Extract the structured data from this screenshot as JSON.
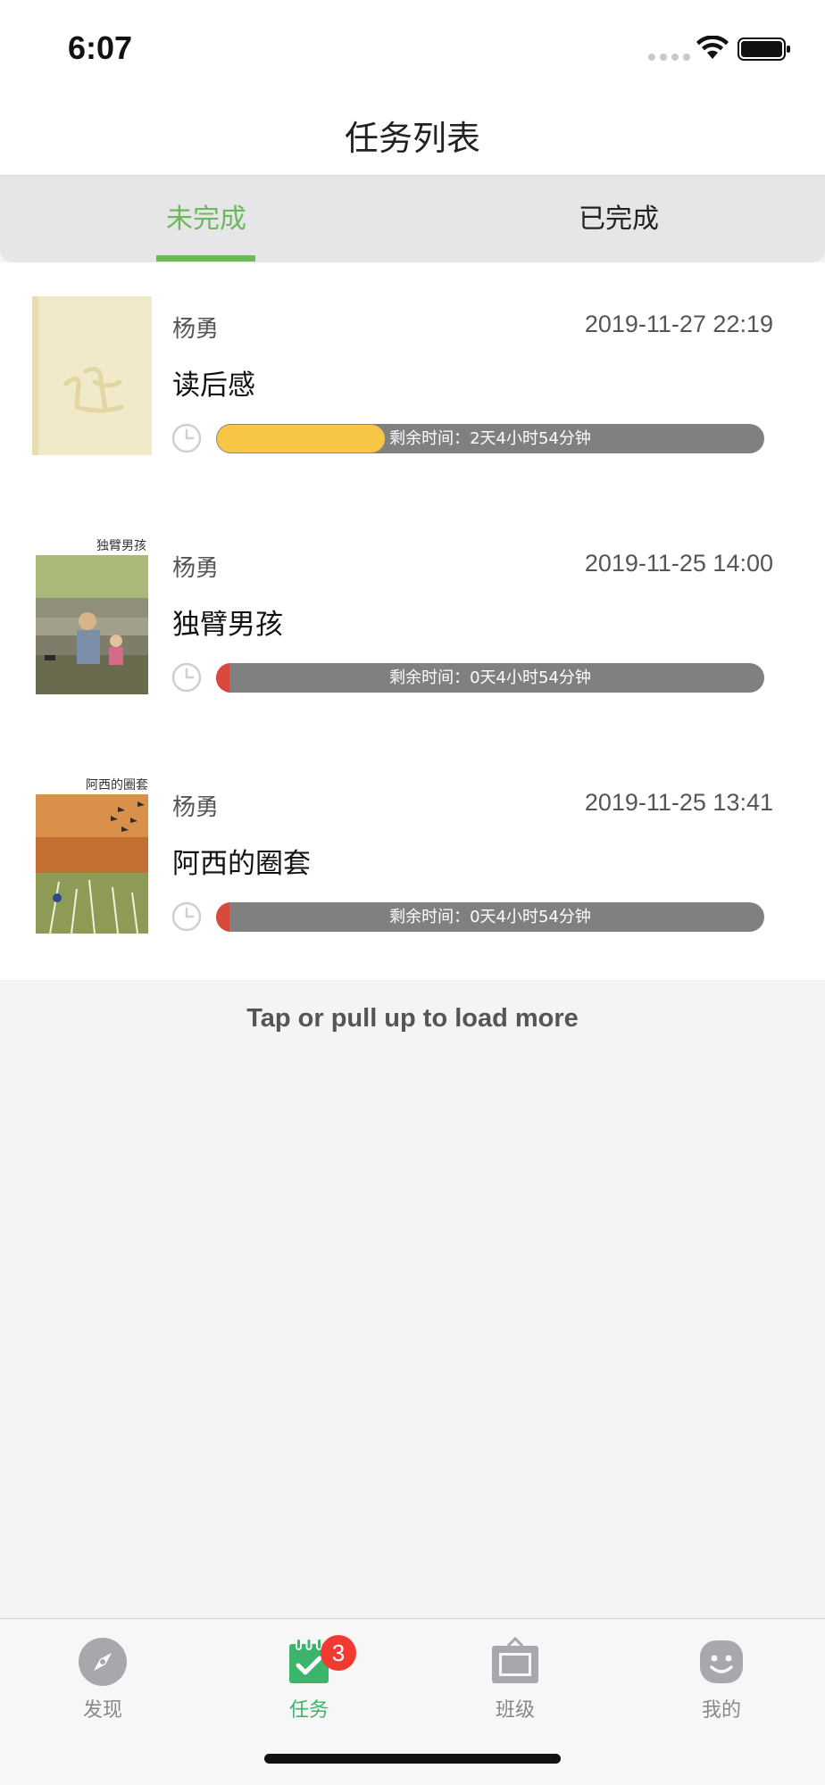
{
  "status_bar": {
    "time": "6:07"
  },
  "nav": {
    "title": "任务列表"
  },
  "tabs": {
    "active": "未完成",
    "inactive": "已完成"
  },
  "tasks": [
    {
      "author": "杨勇",
      "date": "2019-11-27 22:19",
      "title": "读后感",
      "remaining": "剩余时间：2天4小时54分钟",
      "progress": 0.31,
      "bar_color": "#f8c645"
    },
    {
      "author": "杨勇",
      "date": "2019-11-25 14:00",
      "title": "独臂男孩",
      "remaining": "剩余时间：0天4小时54分钟",
      "progress": 0.025,
      "bar_color": "#d9493b"
    },
    {
      "author": "杨勇",
      "date": "2019-11-25 13:41",
      "title": "阿西的圈套",
      "remaining": "剩余时间：0天4小时54分钟",
      "progress": 0.025,
      "bar_color": "#d9493b"
    }
  ],
  "load_more": "Tap or pull up to load more",
  "tabbar": {
    "items": [
      {
        "label": "发现",
        "icon": "compass-icon"
      },
      {
        "label": "任务",
        "icon": "calendar-check-icon",
        "badge": "3"
      },
      {
        "label": "班级",
        "icon": "classroom-board-icon"
      },
      {
        "label": "我的",
        "icon": "smiley-face-icon"
      }
    ]
  },
  "colors": {
    "accent": "#6bb95a",
    "tab_active": "#3cb46b",
    "badge": "#f23a33"
  }
}
